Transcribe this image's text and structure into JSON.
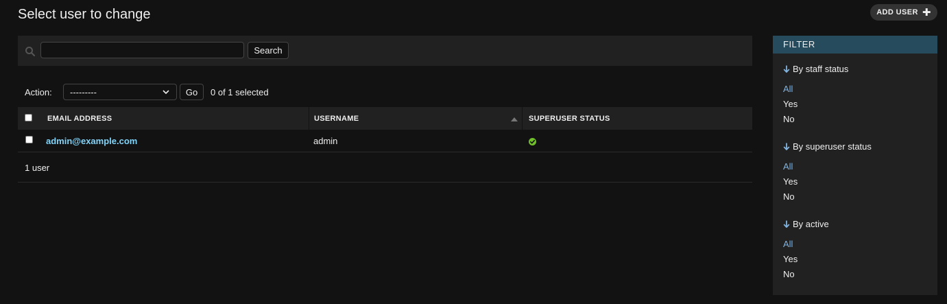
{
  "header": {
    "title": "Select user to change",
    "add_user_label": "ADD USER"
  },
  "search": {
    "value": "",
    "button_label": "Search"
  },
  "actions": {
    "label": "Action:",
    "selected_option": "---------",
    "go_label": "Go",
    "selection_count": "0 of 1 selected"
  },
  "table": {
    "columns": [
      "EMAIL ADDRESS",
      "USERNAME",
      "SUPERUSER STATUS"
    ],
    "sorted_column": "USERNAME",
    "sort_direction": "ascending",
    "rows": [
      {
        "email": "admin@example.com",
        "username": "admin",
        "superuser": true
      }
    ]
  },
  "paginator": {
    "text": "1 user"
  },
  "filter": {
    "title": "FILTER",
    "groups": [
      {
        "title": "By staff status",
        "options": [
          "All",
          "Yes",
          "No"
        ],
        "selected": "All"
      },
      {
        "title": "By superuser status",
        "options": [
          "All",
          "Yes",
          "No"
        ],
        "selected": "All"
      },
      {
        "title": "By active",
        "options": [
          "All",
          "Yes",
          "No"
        ],
        "selected": "All"
      }
    ]
  },
  "colors": {
    "background": "#121212",
    "panel": "#212121",
    "link": "#81d4fa",
    "filter_header": "#264b5d",
    "filter_selected": "#81b4e0",
    "success": "#70bf2b"
  },
  "icons": {
    "add": "plus-icon",
    "search": "magnifier-icon",
    "sort": "triangle-up-icon",
    "superuser_true": "check-circle-icon",
    "filter_group": "arrow-down-icon",
    "select": "chevron-down-icon"
  }
}
